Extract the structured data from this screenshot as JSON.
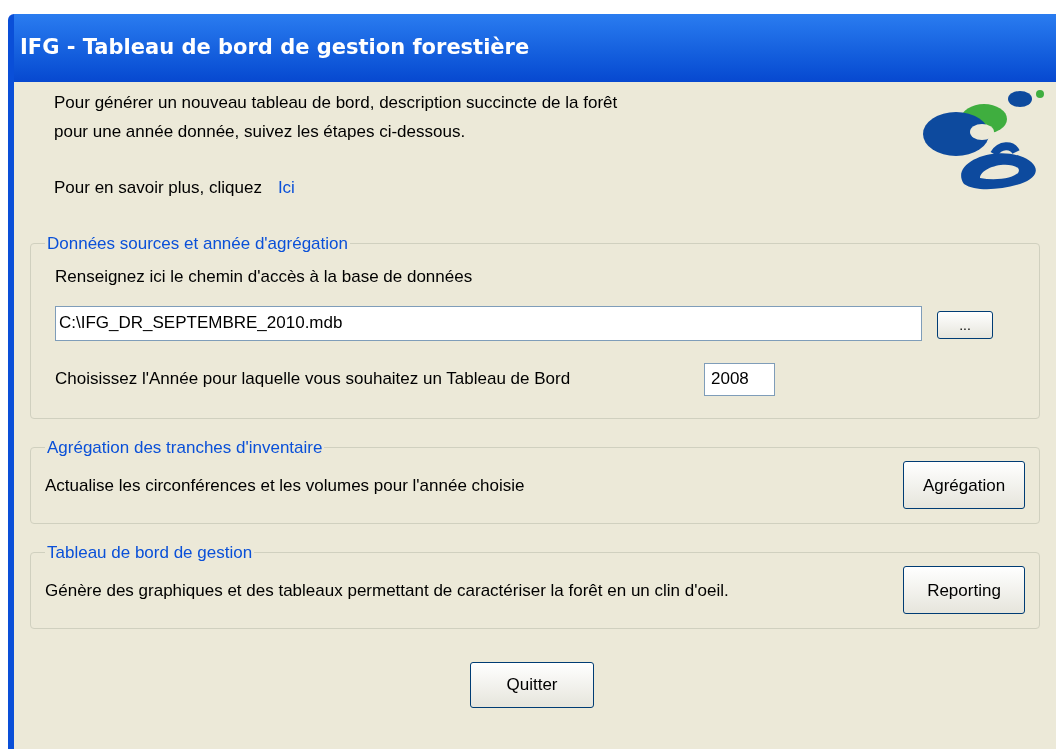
{
  "window": {
    "title": "IFG - Tableau de bord de gestion forestière"
  },
  "intro": {
    "lines": [
      "Pour générer un nouveau tableau de bord, description succincte de la forêt",
      "pour une année donnée, suivez les étapes ci-dessous."
    ],
    "more_text": "Pour en savoir plus, cliquez",
    "more_link": "Ici"
  },
  "source_group": {
    "legend": "Données sources et année d'agrégation",
    "path_label": "Renseignez ici le chemin d'accès à la base de données",
    "path_value": "C:\\IFG_DR_SEPTEMBRE_2010.mdb",
    "browse_button": "...",
    "year_label": "Choisissez l'Année pour laquelle vous souhaitez un Tableau de Bord",
    "year_value": "2008"
  },
  "action_groups": [
    {
      "legend": "Agrégation des tranches d'inventaire",
      "text": "Actualise les circonférences et les volumes pour l'année choisie",
      "button": "Agrégation"
    },
    {
      "legend": "Tableau de bord de gestion",
      "text": "Génère des graphiques et des tableaux permettant de caractériser la forêt en un clin d'oeil.",
      "button": "Reporting"
    }
  ],
  "quit_button": "Quitter"
}
